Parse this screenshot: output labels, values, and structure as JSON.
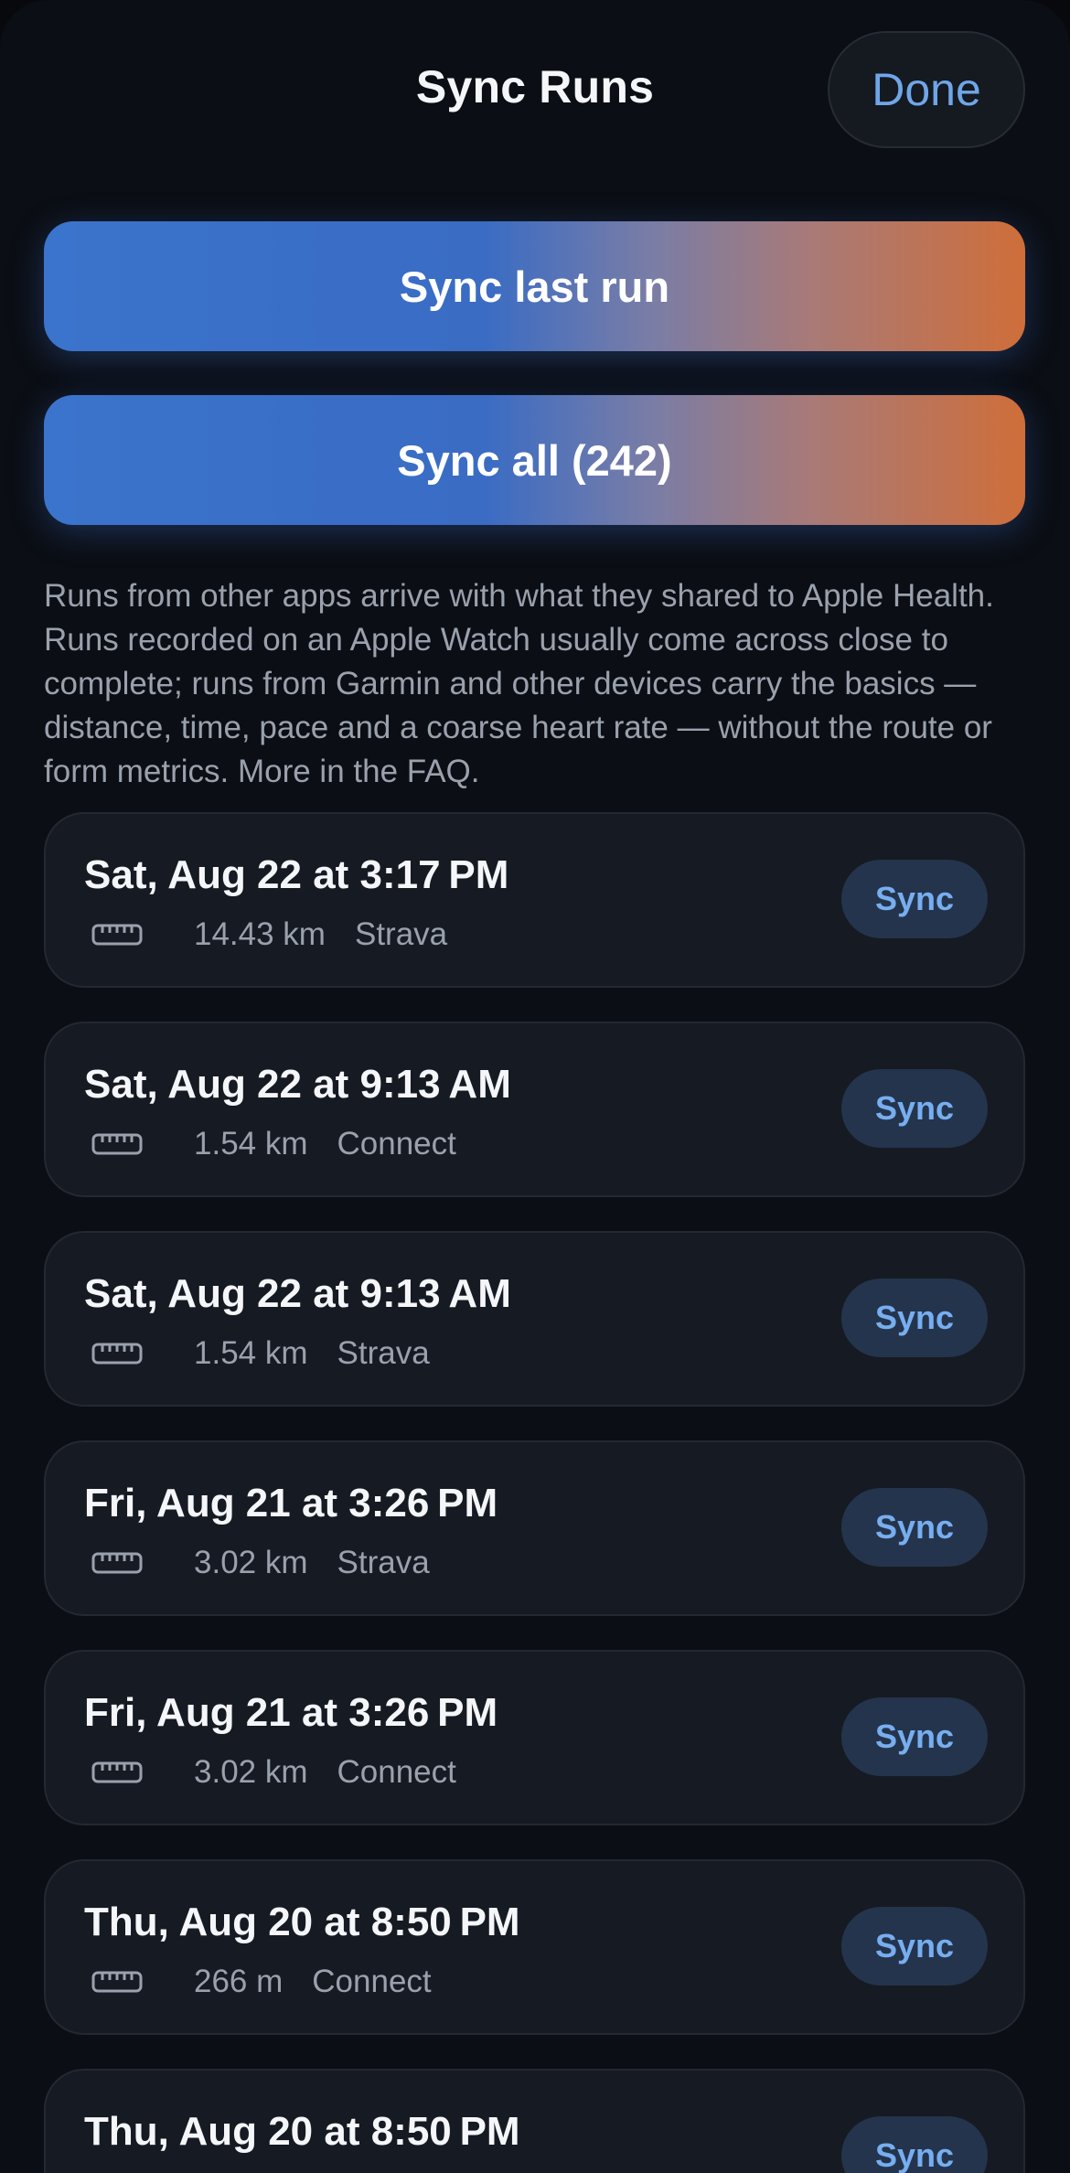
{
  "header": {
    "title": "Sync Runs",
    "done_label": "Done"
  },
  "actions": {
    "sync_last_label": "Sync last run",
    "sync_all_label": "Sync all (242)"
  },
  "info_text": "Runs from other apps arrive with what they shared to Apple Health. Runs recorded on an Apple Watch usually come across close to complete; runs from Garmin and other devices carry the basics — distance, time, pace and a coarse heart rate — without the route or form metrics. More in the FAQ.",
  "runs": [
    {
      "date": "Sat, Aug 22 at 3:17 PM",
      "distance": "14.43 km",
      "source": "Strava",
      "sync_label": "Sync",
      "icon": "ruler-icon"
    },
    {
      "date": "Sat, Aug 22 at 9:13 AM",
      "distance": "1.54 km",
      "source": "Connect",
      "sync_label": "Sync",
      "icon": "ruler-icon"
    },
    {
      "date": "Sat, Aug 22 at 9:13 AM",
      "distance": "1.54 km",
      "source": "Strava",
      "sync_label": "Sync",
      "icon": "ruler-icon"
    },
    {
      "date": "Fri, Aug 21 at 3:26 PM",
      "distance": "3.02 km",
      "source": "Strava",
      "sync_label": "Sync",
      "icon": "ruler-icon"
    },
    {
      "date": "Fri, Aug 21 at 3:26 PM",
      "distance": "3.02 km",
      "source": "Connect",
      "sync_label": "Sync",
      "icon": "ruler-icon"
    },
    {
      "date": "Thu, Aug 20 at 8:50 PM",
      "distance": "266 m",
      "source": "Connect",
      "sync_label": "Sync",
      "icon": "ruler-icon"
    },
    {
      "date": "Thu, Aug 20 at 8:50 PM",
      "distance": "",
      "source": "",
      "sync_label": "Sync",
      "icon": "ruler-icon"
    }
  ],
  "colors": {
    "background": "#0b0e14",
    "card": "#161a22",
    "accent_blue": "#6fa6e8",
    "gradient_start": "#3b74cc",
    "gradient_end": "#cf6e3a"
  }
}
